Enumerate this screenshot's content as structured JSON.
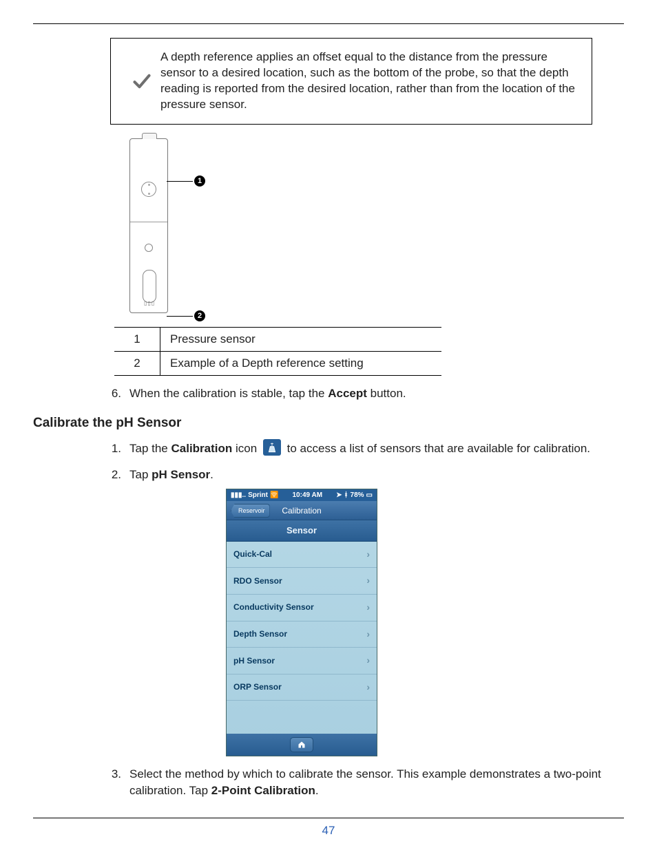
{
  "callout": {
    "text": "A depth reference applies an offset equal to the distance from the pressure sensor to a desired location, such as the bottom of the probe, so that the depth reading is reported from the desired location, rather than from the location of the pressure sensor."
  },
  "diagram_key": {
    "rows": [
      {
        "num": "1",
        "desc": "Pressure sensor"
      },
      {
        "num": "2",
        "desc": "Example of a Depth reference setting"
      }
    ]
  },
  "step6": {
    "num": "6.",
    "pre": "When the calibration is stable, tap the ",
    "bold": "Accept",
    "post": " button."
  },
  "section_heading": "Calibrate the pH Sensor",
  "ph_steps": {
    "s1": {
      "num": "1.",
      "pre": "Tap the ",
      "bold": "Calibration",
      "mid": " icon ",
      "post": " to access a list of sensors that are available for calibration."
    },
    "s2": {
      "num": "2.",
      "pre": "Tap ",
      "bold": "pH Sensor",
      "post": "."
    },
    "s3": {
      "num": "3.",
      "pre": "Select the method by which to calibrate the sensor. This example demonstrates a two-point calibration. Tap ",
      "bold": "2-Point Calibration",
      "post": "."
    }
  },
  "phone": {
    "status_left": "Sprint",
    "status_time": "10:49 AM",
    "status_right": "78%",
    "title": "Calibration",
    "back": "Reservoir",
    "tab": "Sensor",
    "items": [
      "Quick-Cal",
      "RDO Sensor",
      "Conductivity Sensor",
      "Depth Sensor",
      "pH Sensor",
      "ORP Sensor"
    ]
  },
  "page_number": "47"
}
